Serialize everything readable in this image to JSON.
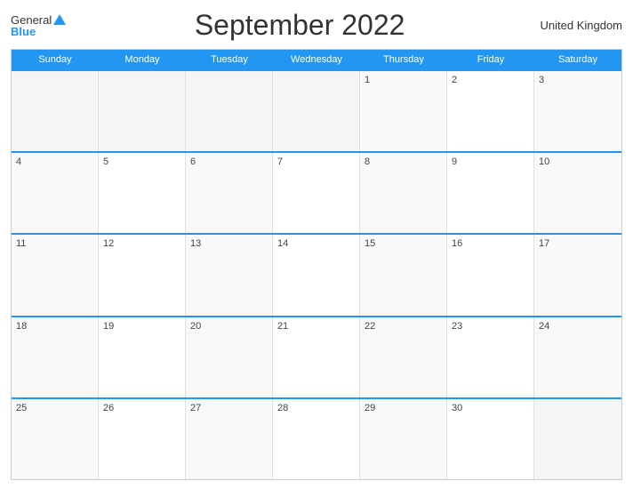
{
  "header": {
    "logo_general": "General",
    "logo_blue": "Blue",
    "title": "September 2022",
    "country": "United Kingdom"
  },
  "days": [
    "Sunday",
    "Monday",
    "Tuesday",
    "Wednesday",
    "Thursday",
    "Friday",
    "Saturday"
  ],
  "weeks": [
    [
      "",
      "",
      "",
      "",
      "1",
      "2",
      "3"
    ],
    [
      "4",
      "5",
      "6",
      "7",
      "8",
      "9",
      "10"
    ],
    [
      "11",
      "12",
      "13",
      "14",
      "15",
      "16",
      "17"
    ],
    [
      "18",
      "19",
      "20",
      "21",
      "22",
      "23",
      "24"
    ],
    [
      "25",
      "26",
      "27",
      "28",
      "29",
      "30",
      ""
    ]
  ]
}
